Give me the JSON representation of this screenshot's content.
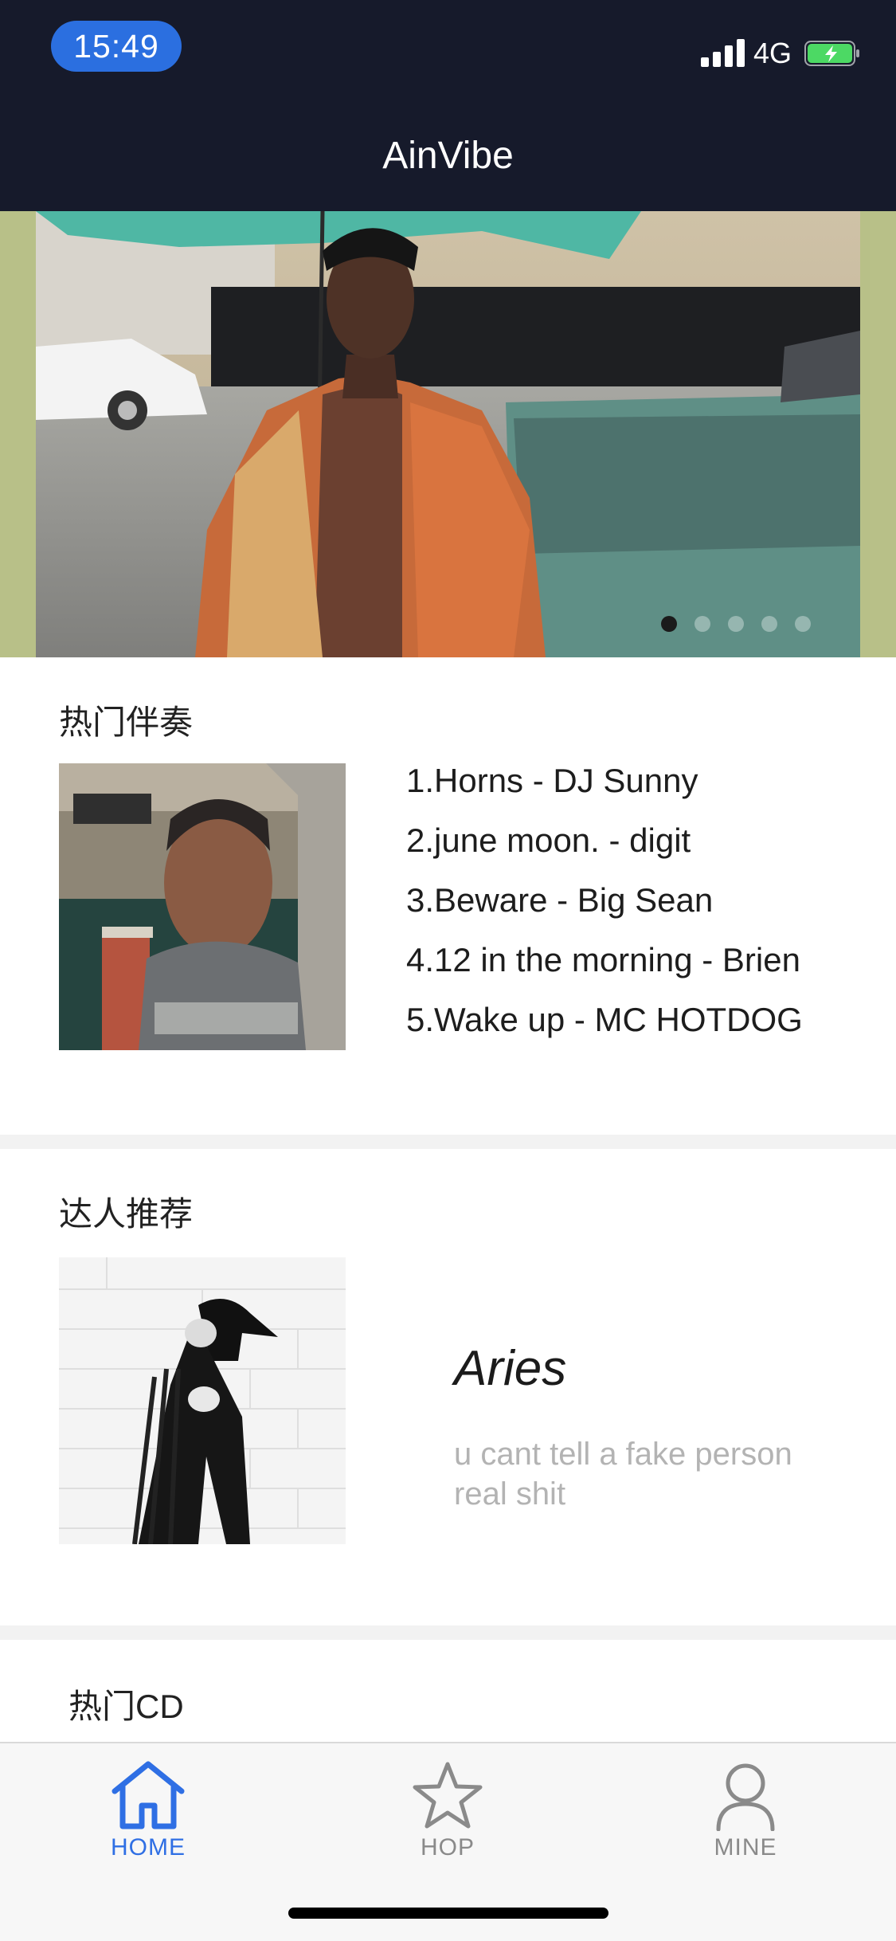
{
  "status_bar": {
    "time": "15:49",
    "network": "4G"
  },
  "app": {
    "title": "AinVibe"
  },
  "banner": {
    "dot_count": 5,
    "active_dot": 0
  },
  "hot_accompaniment": {
    "title": "热门伴奏",
    "tracks": [
      "1.Horns  - DJ Sunny",
      "2.june moon.  - digit",
      "3.Beware  - Big Sean",
      "4.12 in the morning  - Brien",
      "5.Wake up  - MC HOTDOG"
    ]
  },
  "recommended": {
    "title": "达人推荐",
    "artist_name": "Aries",
    "artist_quote": "u cant tell a fake person real shit"
  },
  "hot_cd": {
    "title": "热门CD"
  },
  "tabbar": {
    "tabs": [
      {
        "label": "HOME",
        "icon": "home-icon",
        "active": true
      },
      {
        "label": "HOP",
        "icon": "star-icon",
        "active": false
      },
      {
        "label": "MINE",
        "icon": "person-icon",
        "active": false
      }
    ],
    "active_color": "#2f6fe4",
    "inactive_color": "#8a8a8a"
  }
}
